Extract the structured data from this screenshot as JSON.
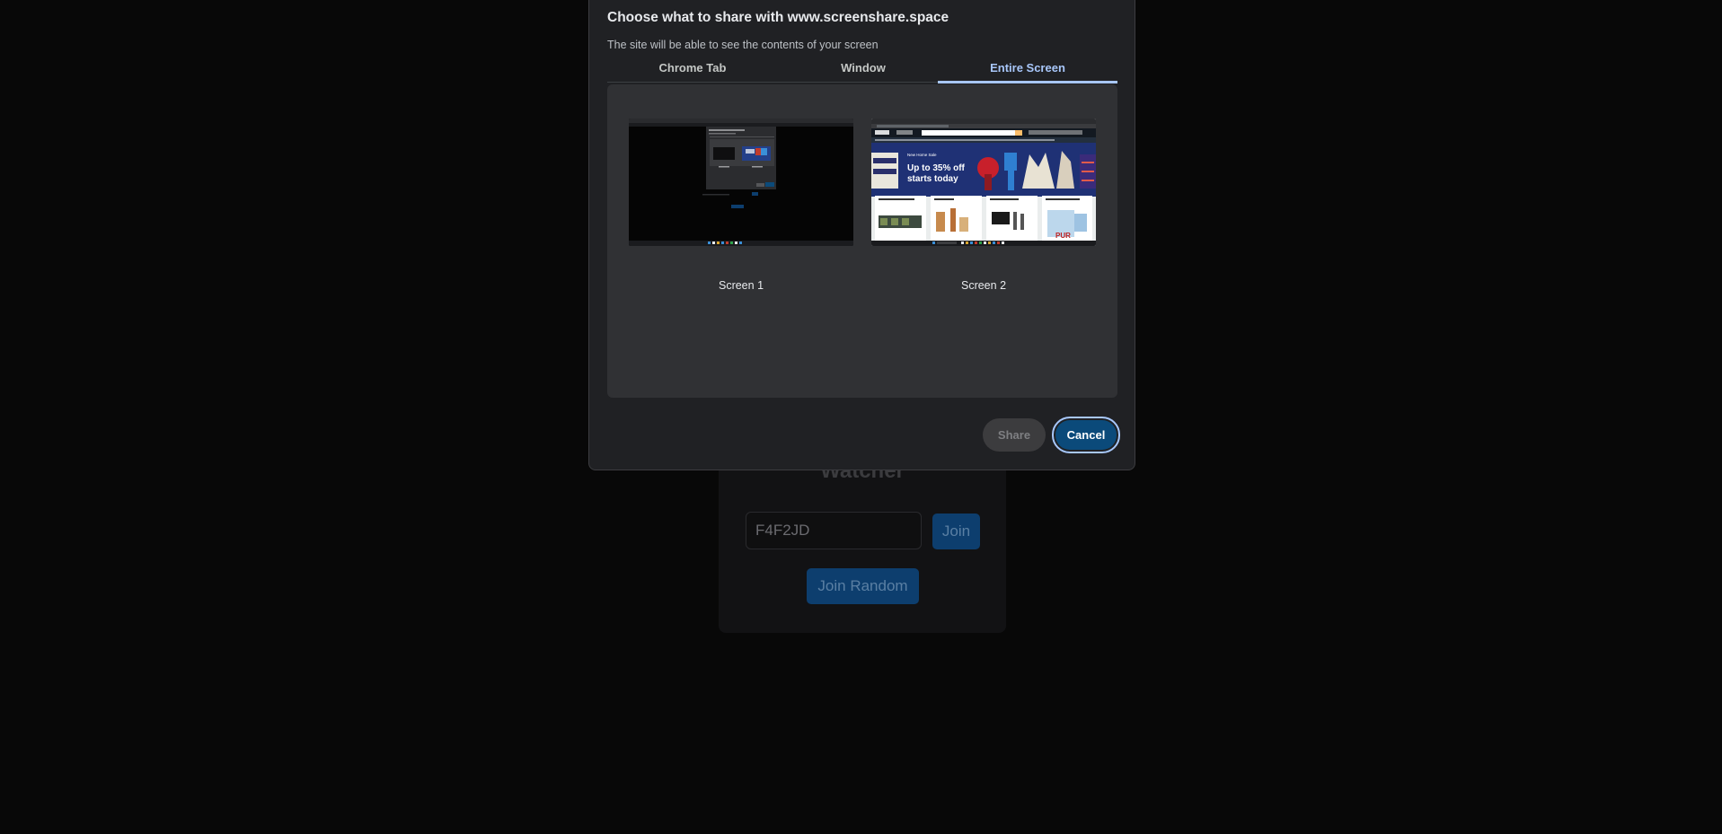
{
  "watcher": {
    "title": "Watcher",
    "room_code_value": "F4F2JD",
    "join_label": "Join",
    "join_random_label": "Join Random"
  },
  "dialog": {
    "title": "Choose what to share with www.screenshare.space",
    "subtitle": "The site will be able to see the contents of your screen",
    "tabs": [
      {
        "label": "Chrome Tab",
        "selected": false
      },
      {
        "label": "Window",
        "selected": false
      },
      {
        "label": "Entire Screen",
        "selected": true
      }
    ],
    "screens": [
      {
        "label": "Screen 1"
      },
      {
        "label": "Screen 2"
      }
    ],
    "thumbnail_text": {
      "promo_line1": "Up to 35% off",
      "promo_line2": "starts today"
    },
    "share_label": "Share",
    "cancel_label": "Cancel"
  },
  "colors": {
    "accent": "#a8c7fa",
    "dialog_bg": "#202124",
    "panel_bg": "#303134",
    "cancel_bg": "#0b4a7a",
    "page_bg": "#080808"
  }
}
